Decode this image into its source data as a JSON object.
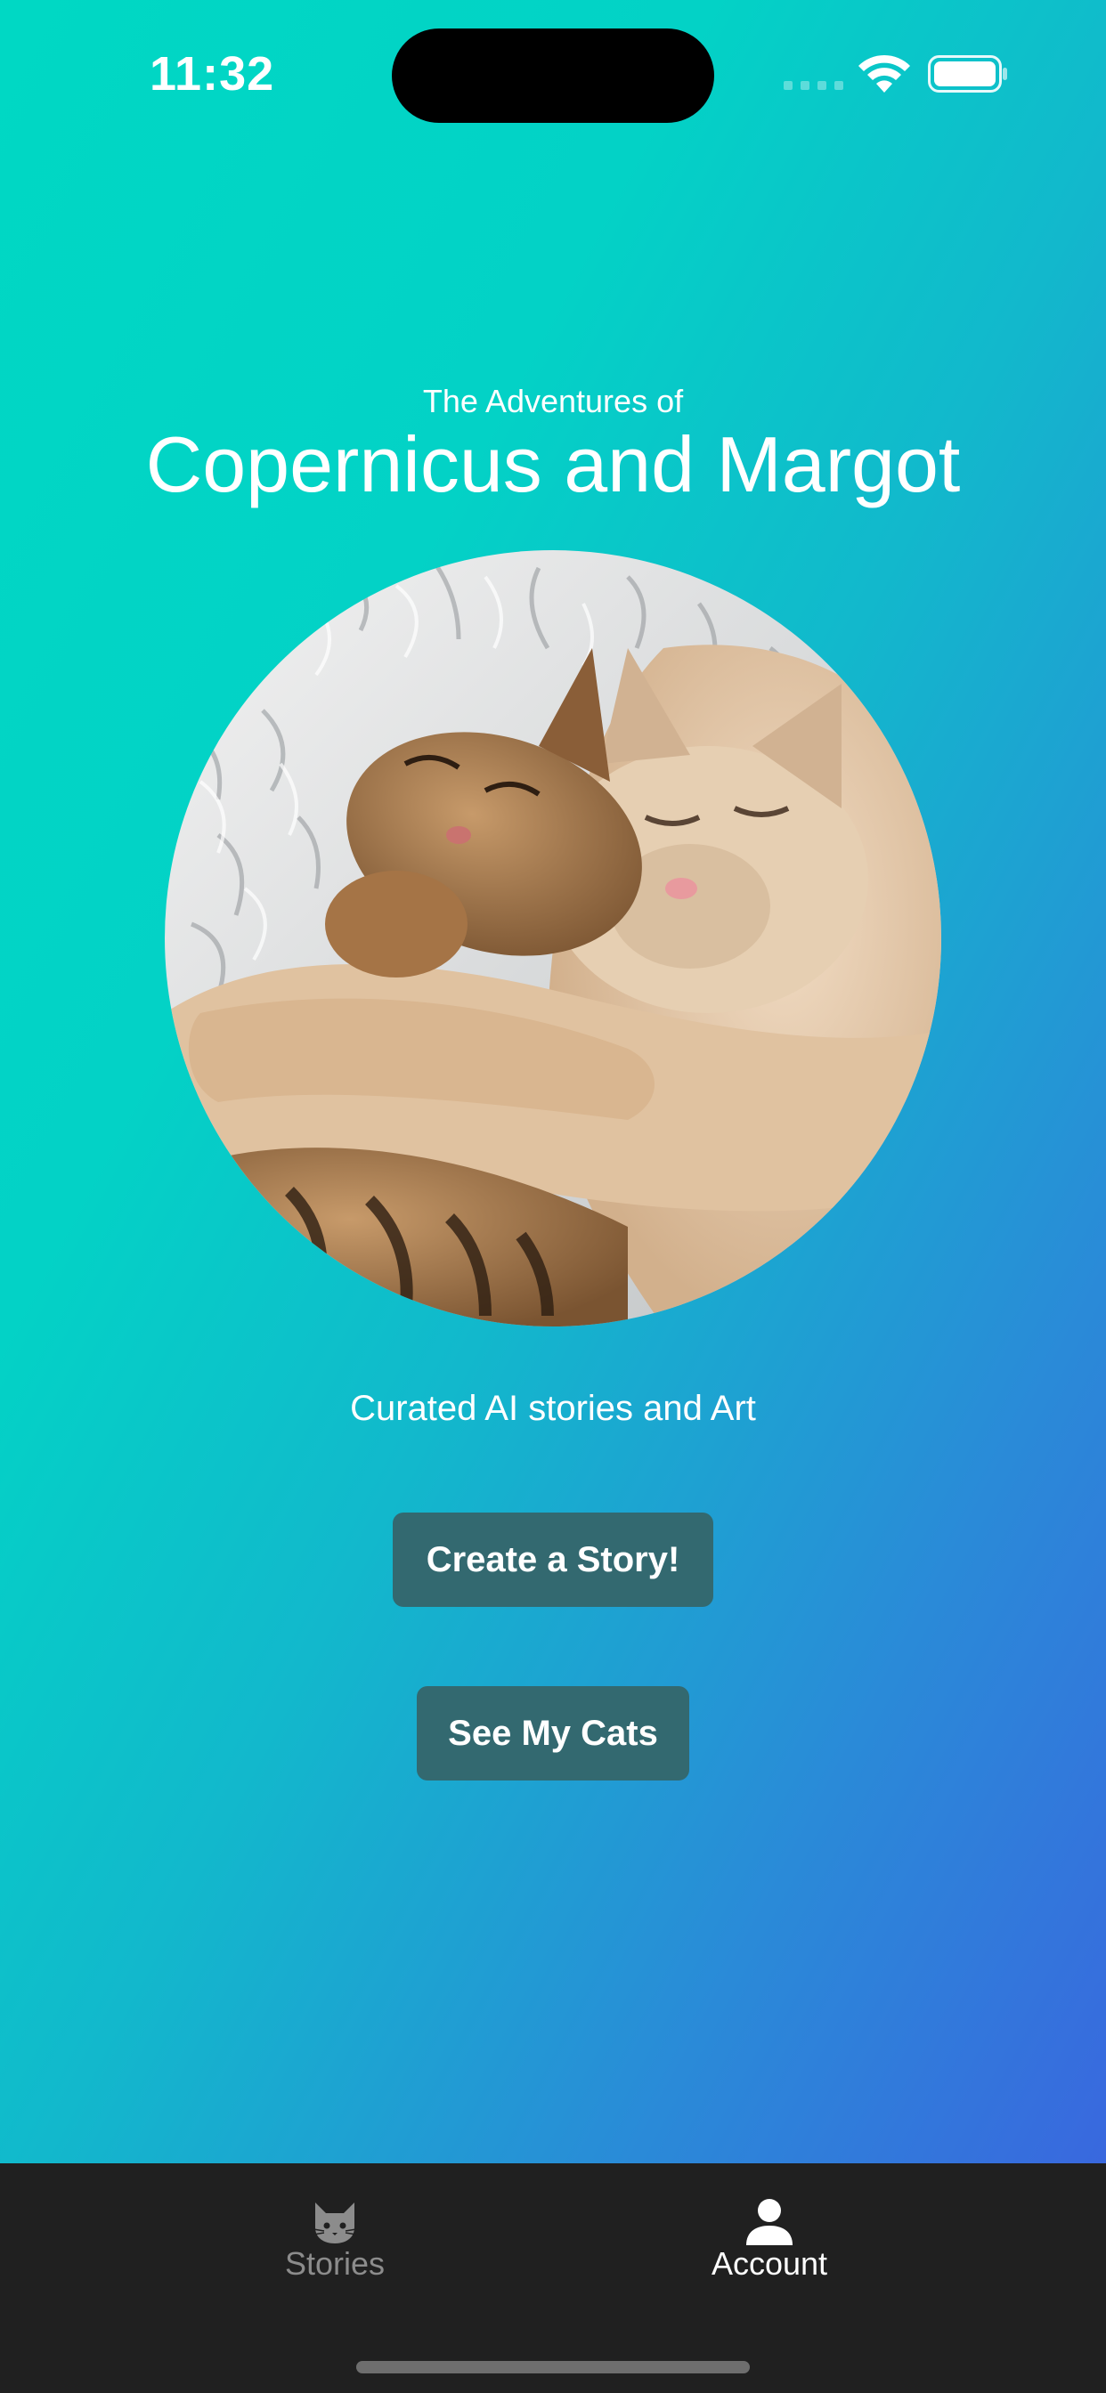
{
  "status_bar": {
    "time": "11:32"
  },
  "header": {
    "subtitle": "The Adventures of",
    "title": "Copernicus and Margot"
  },
  "photo": {
    "description_icon": "cats-photo"
  },
  "tagline": "Curated AI stories and Art",
  "buttons": {
    "create_story": "Create a Story!",
    "see_cats": "See My Cats"
  },
  "tabbar": {
    "items": [
      {
        "label": "Stories",
        "icon": "cat-icon",
        "active": false
      },
      {
        "label": "Account",
        "icon": "person-icon",
        "active": true
      }
    ]
  },
  "colors": {
    "gradient_start": "#00d8c4",
    "gradient_end": "#3d5fe0",
    "button_bg": "#336970",
    "tabbar_bg": "#202020",
    "tab_inactive": "#8c8c8c",
    "tab_active": "#ffffff"
  }
}
